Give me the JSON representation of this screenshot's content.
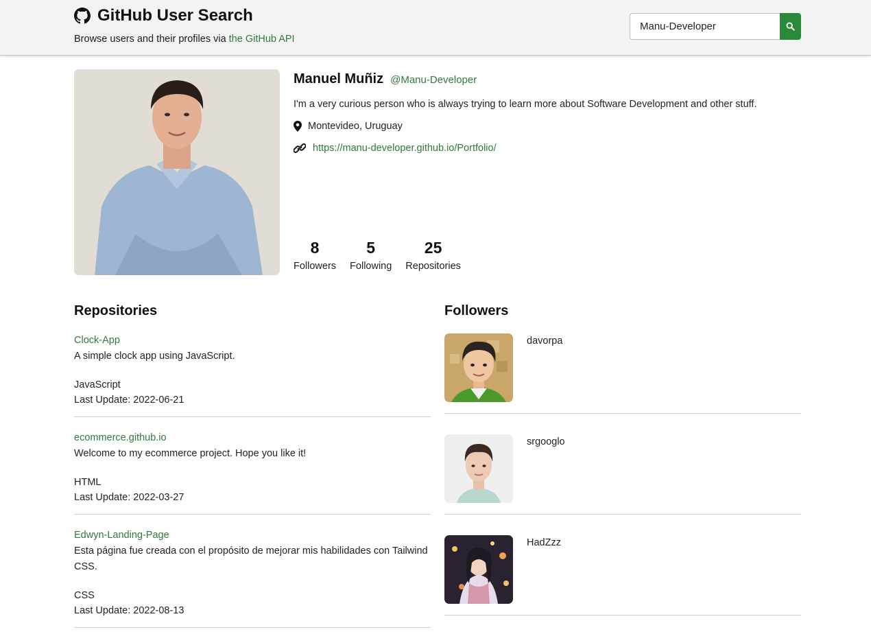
{
  "header": {
    "title": "GitHub User Search",
    "subtitle_prefix": "Browse users and their profiles via ",
    "subtitle_link": "the GitHub API",
    "logo_icon": "github-icon"
  },
  "search": {
    "value": "Manu-Developer",
    "button_icon": "search-icon"
  },
  "colors": {
    "accent": "#2a8a39",
    "link": "#2f7a3a"
  },
  "profile": {
    "name": "Manuel Muñiz",
    "login": "@Manu-Developer",
    "bio": "I'm a very curious person who is always trying to learn more about Software Development and other stuff.",
    "location": "Montevideo, Uruguay",
    "blog": "https://manu-developer.github.io/Portfolio/",
    "stats": [
      {
        "value": "8",
        "label": "Followers"
      },
      {
        "value": "5",
        "label": "Following"
      },
      {
        "value": "25",
        "label": "Repositories"
      }
    ]
  },
  "repositories": {
    "title": "Repositories",
    "last_update_prefix": "Last Update: ",
    "items": [
      {
        "name": "Clock-App",
        "description": "A simple clock app using JavaScript.",
        "language": "JavaScript",
        "last_update": "Last Update: 2022-06-21"
      },
      {
        "name": "ecommerce.github.io",
        "description": "Welcome to my ecommerce project. Hope you like it!",
        "language": "HTML",
        "last_update": "Last Update: 2022-03-27"
      },
      {
        "name": "Edwyn-Landing-Page",
        "description": "Esta página fue creada con el propósito de mejorar mis habilidades con Tailwind CSS.",
        "language": "CSS",
        "last_update": "Last Update: 2022-08-13"
      }
    ]
  },
  "followers": {
    "title": "Followers",
    "items": [
      {
        "login": "davorpa"
      },
      {
        "login": "srgooglo"
      },
      {
        "login": "HadZzz"
      }
    ]
  }
}
